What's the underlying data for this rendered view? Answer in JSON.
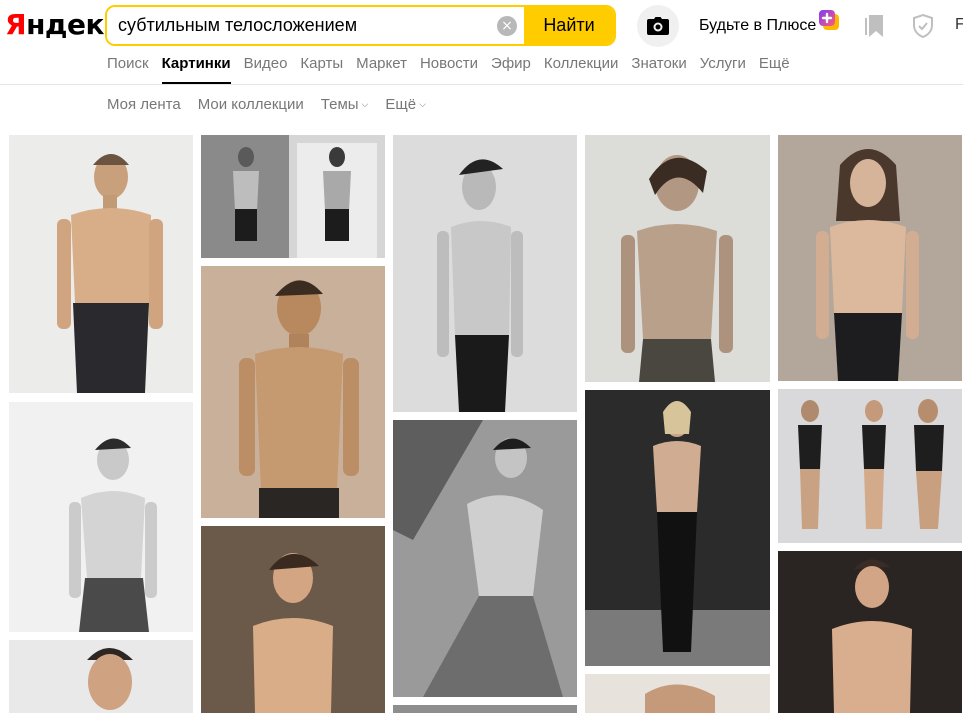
{
  "header": {
    "logo_first": "Я",
    "logo_rest": "ндекс",
    "search_value": "субтильным телосложением",
    "clear_glyph": "×",
    "find_label": "Найти",
    "plus_label": "Будьте в Плюсе",
    "cut_text": "F"
  },
  "tabs": [
    {
      "label": "Поиск"
    },
    {
      "label": "Картинки",
      "active": true
    },
    {
      "label": "Видео"
    },
    {
      "label": "Карты"
    },
    {
      "label": "Маркет"
    },
    {
      "label": "Новости"
    },
    {
      "label": "Эфир"
    },
    {
      "label": "Коллекции"
    },
    {
      "label": "Знатоки"
    },
    {
      "label": "Услуги"
    },
    {
      "label": "Ещё"
    }
  ],
  "subnav": {
    "feed": "Моя лента",
    "collections": "Мои коллекции",
    "themes": "Темы",
    "more": "Ещё"
  },
  "colors": {
    "accent": "#ffcc00",
    "logo_red": "#ff0000",
    "plus_gradient_start": "#7b3cf5",
    "plus_gradient_end": "#ff5a7a"
  },
  "icons": {
    "camera": "camera-icon",
    "bookmark": "bookmark-icon",
    "shield": "shield-icon",
    "clear": "clear-icon",
    "plus": "plus-badge-icon"
  }
}
